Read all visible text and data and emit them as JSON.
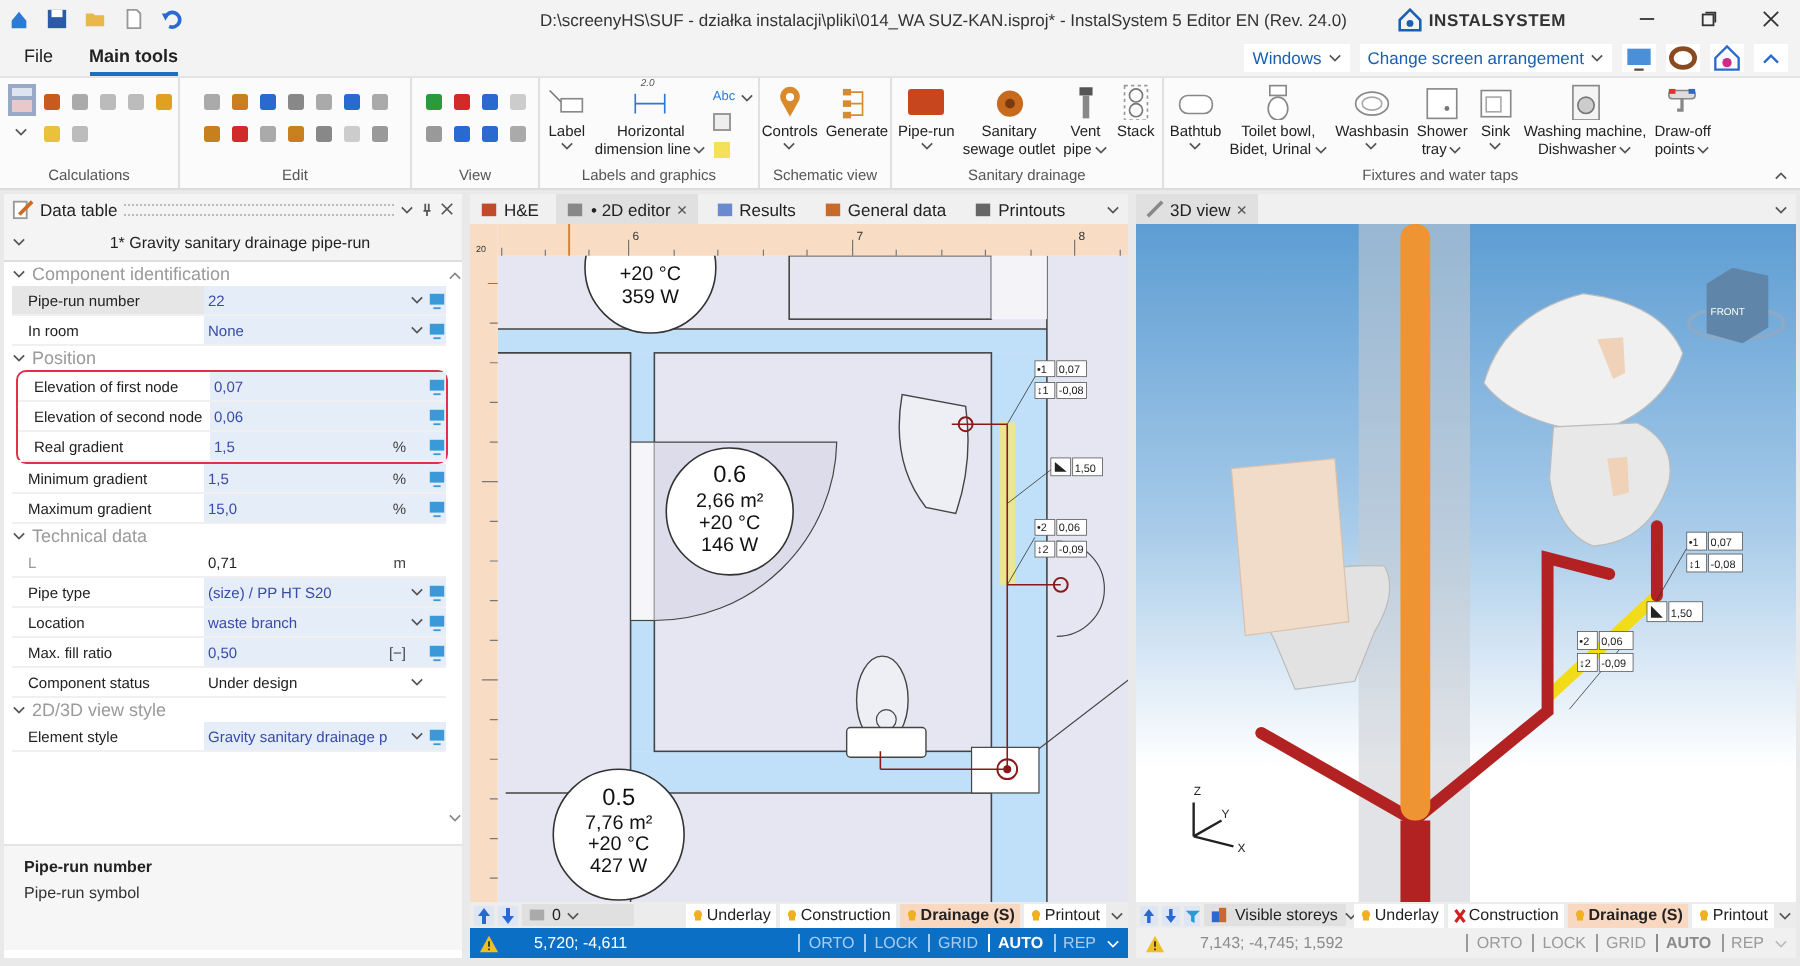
{
  "title_bar": {
    "title": "D:\\screenyHS\\SUF - działka instalacji\\pliki\\014_WA SUZ-KAN.isproj* - InstalSystem 5 Editor EN (Rev. 24.0)",
    "logo": "INSTALSYSTEM"
  },
  "ribbon_tabs": [
    {
      "label": "File",
      "selected": false
    },
    {
      "label": "Main tools",
      "selected": true
    }
  ],
  "ribbon_right": {
    "windows": "Windows",
    "arrangement": "Change screen arrangement"
  },
  "ribbon_groups": [
    {
      "label": "Calculations"
    },
    {
      "label": "Edit"
    },
    {
      "label": "View"
    },
    {
      "label": "Labels and graphics",
      "style_text": "Abc",
      "buttons": [
        {
          "lines": [
            "Label"
          ],
          "dropdown": true
        },
        {
          "lines": [
            "Horizontal",
            "dimension line"
          ],
          "dropdown": true,
          "icon_text": "2.0"
        }
      ]
    },
    {
      "label": "Schematic view",
      "buttons": [
        {
          "lines": [
            "Controls"
          ],
          "dropdown": true
        },
        {
          "lines": [
            "Generate"
          ],
          "dropdown": false
        }
      ]
    },
    {
      "label": "Sanitary drainage",
      "buttons": [
        {
          "lines": [
            "Pipe-run"
          ],
          "dropdown": true
        },
        {
          "lines": [
            "Sanitary",
            "sewage outlet"
          ],
          "dropdown": false
        },
        {
          "lines": [
            "Vent",
            "pipe"
          ],
          "dropdown": true
        },
        {
          "lines": [
            "Stack"
          ],
          "dropdown": false
        }
      ]
    },
    {
      "label": "Fixtures and water taps",
      "buttons": [
        {
          "lines": [
            "Bathtub"
          ],
          "dropdown": true
        },
        {
          "lines": [
            "Toilet bowl,",
            "Bidet, Urinal"
          ],
          "dropdown": true
        },
        {
          "lines": [
            "Washbasin"
          ],
          "dropdown": true
        },
        {
          "lines": [
            "Shower",
            "tray"
          ],
          "dropdown": true
        },
        {
          "lines": [
            "Sink"
          ],
          "dropdown": true
        },
        {
          "lines": [
            "Washing machine,",
            "Dishwasher"
          ],
          "dropdown": true
        },
        {
          "lines": [
            "Draw-off",
            "points"
          ],
          "dropdown": true
        }
      ]
    }
  ],
  "data_table": {
    "title": "Data table",
    "component": "1* Gravity sanitary drainage pipe-run",
    "sections": [
      {
        "title": "Component identification",
        "expanded": true,
        "rows": [
          {
            "label": "Pipe-run number",
            "value": "22",
            "dropdown": true,
            "link": true,
            "editable": true,
            "selected": true,
            "highlighted": false,
            "disabled": false
          },
          {
            "label": "In room",
            "value": "None",
            "dropdown": true,
            "link": true,
            "editable": true,
            "selected": false,
            "highlighted": false,
            "disabled": false
          }
        ]
      },
      {
        "title": "Position",
        "expanded": true,
        "rows": [
          {
            "label": "Elevation of first node",
            "value": "0,07",
            "dropdown": false,
            "link": true,
            "editable": true,
            "selected": false,
            "highlighted": true,
            "disabled": false
          },
          {
            "label": "Elevation of second node",
            "value": "0,06",
            "dropdown": false,
            "link": true,
            "editable": true,
            "selected": false,
            "highlighted": true,
            "disabled": false
          },
          {
            "label": "Real gradient",
            "value": "1,5",
            "unit": "%",
            "dropdown": false,
            "link": true,
            "editable": true,
            "selected": false,
            "highlighted": true,
            "disabled": false
          },
          {
            "label": "Minimum gradient",
            "value": "1,5",
            "unit": "%",
            "dropdown": false,
            "link": true,
            "editable": true,
            "selected": false,
            "highlighted": false,
            "disabled": false
          },
          {
            "label": "Maximum gradient",
            "value": "15,0",
            "unit": "%",
            "dropdown": false,
            "link": true,
            "editable": true,
            "selected": false,
            "highlighted": false,
            "disabled": false
          }
        ]
      },
      {
        "title": "Technical data",
        "expanded": true,
        "rows": [
          {
            "label": "L",
            "value": "0,71",
            "unit": "m",
            "dropdown": false,
            "link": false,
            "editable": false,
            "selected": false,
            "highlighted": false,
            "disabled": true
          },
          {
            "label": "Pipe type",
            "value": "(size) / PP HT S20",
            "dropdown": true,
            "link": true,
            "editable": true,
            "selected": false,
            "highlighted": false,
            "disabled": false
          },
          {
            "label": "Location",
            "value": "waste branch",
            "dropdown": true,
            "link": true,
            "editable": true,
            "selected": false,
            "highlighted": false,
            "disabled": false
          },
          {
            "label": "Max. fill ratio",
            "value": "0,50",
            "unit": "[−]",
            "dropdown": false,
            "link": true,
            "editable": true,
            "selected": false,
            "highlighted": false,
            "disabled": false
          },
          {
            "label": "Component status",
            "value": "Under design",
            "dropdown": true,
            "link": false,
            "editable": false,
            "selected": false,
            "highlighted": false,
            "disabled": false
          }
        ]
      },
      {
        "title": "2D/3D view style",
        "expanded": true,
        "rows": [
          {
            "label": "Element style",
            "value": "Gravity sanitary drainage p",
            "dropdown": true,
            "link": true,
            "editable": true,
            "selected": false,
            "highlighted": false,
            "disabled": false
          }
        ]
      }
    ],
    "description": {
      "title": "Pipe-run number",
      "text": "Pipe-run symbol"
    }
  },
  "editor": {
    "tabs": [
      {
        "label": "H&E",
        "selected": false,
        "closable": false
      },
      {
        "label": "• 2D editor",
        "selected": true,
        "closable": true,
        "close": "×"
      },
      {
        "label": "Results",
        "selected": false,
        "closable": false
      },
      {
        "label": "General data",
        "selected": false,
        "closable": false
      },
      {
        "label": "Printouts",
        "selected": false,
        "closable": false
      }
    ],
    "ruler": {
      "corner": "20",
      "marks": [
        "6",
        "7",
        "8"
      ]
    },
    "rooms": [
      {
        "temperature": "+20 °C",
        "heat": "359 W"
      },
      {
        "number": "0.6",
        "area": "2,66 m²",
        "temperature": "+20 °C",
        "heat": "146 W"
      },
      {
        "number": "0.5",
        "area": "7,76 m²",
        "temperature": "+20 °C",
        "heat": "427 W"
      }
    ],
    "tags": [
      {
        "marker": "•1",
        "value": "0,07"
      },
      {
        "marker": "↕1",
        "value": "-0,08"
      },
      {
        "slope": "1,50"
      },
      {
        "marker": "•2",
        "value": "0,06"
      },
      {
        "marker": "↕2",
        "value": "-0,09"
      }
    ],
    "layer_select": "0",
    "layers": [
      {
        "label": "Underlay",
        "visible": true,
        "selected": false
      },
      {
        "label": "Construction",
        "visible": true,
        "selected": false
      },
      {
        "label": "Drainage (S)",
        "visible": true,
        "selected": true
      },
      {
        "label": "Printout",
        "visible": true,
        "selected": false
      }
    ],
    "status": {
      "active": true,
      "coords": "5,720; -4,611",
      "flags": [
        {
          "label": "ORTO",
          "on": false
        },
        {
          "label": "LOCK",
          "on": false
        },
        {
          "label": "GRID",
          "on": false
        },
        {
          "label": "AUTO",
          "on": true
        },
        {
          "label": "REP",
          "on": false
        }
      ]
    }
  },
  "view3d": {
    "tabs": [
      {
        "label": "3D view",
        "selected": true,
        "closable": true,
        "close": "×"
      }
    ],
    "cube": "FRONT",
    "axes": [
      "Z",
      "Y",
      "X"
    ],
    "tags": [
      {
        "marker": "•1",
        "value": "0,07"
      },
      {
        "marker": "↕1",
        "value": "-0,08"
      },
      {
        "slope": "1,50"
      },
      {
        "marker": "•2",
        "value": "0,06"
      },
      {
        "marker": "↕2",
        "value": "-0,09"
      }
    ],
    "storeys": "Visible storeys",
    "layers": [
      {
        "label": "Underlay",
        "visible": true,
        "selected": false
      },
      {
        "label": "Construction",
        "visible": false,
        "selected": false
      },
      {
        "label": "Drainage (S)",
        "visible": true,
        "selected": true
      },
      {
        "label": "Printout",
        "visible": true,
        "selected": false
      }
    ],
    "status": {
      "active": false,
      "coords": "7,143; -4,745; 1,592",
      "flags": [
        {
          "label": "ORTO",
          "on": false
        },
        {
          "label": "LOCK",
          "on": false
        },
        {
          "label": "GRID",
          "on": false
        },
        {
          "label": "AUTO",
          "on": true
        },
        {
          "label": "REP",
          "on": false
        }
      ]
    }
  }
}
